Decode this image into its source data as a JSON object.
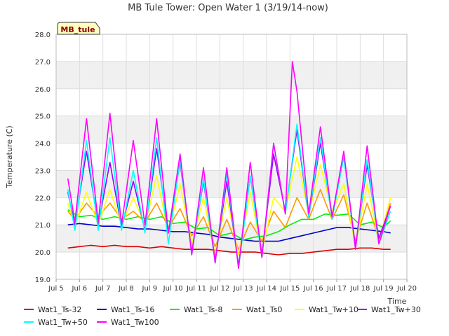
{
  "chart_data": {
    "type": "line",
    "title": "MB Tule Tower: Open Water 1 (3/19/14-now)",
    "xlabel": "Time",
    "ylabel": "Temperature (C)",
    "ylim": [
      19.0,
      28.0
    ],
    "xlim": [
      5,
      20
    ],
    "yticks": [
      "19.0",
      "20.0",
      "21.0",
      "22.0",
      "23.0",
      "24.0",
      "25.0",
      "26.0",
      "27.0",
      "28.0"
    ],
    "xticks": [
      "Jul 5",
      "Jul 6",
      "Jul 7",
      "Jul 8",
      "Jul 9",
      "Jul 10",
      "Jul 11",
      "Jul 12",
      "Jul 13",
      "Jul 14",
      "Jul 15",
      "Jul 16",
      "Jul 17",
      "Jul 18",
      "Jul 19",
      "Jul 20"
    ],
    "x_unit": "day of July",
    "grid": true,
    "station_label": "MB_tule",
    "legend_position": "bottom",
    "series": [
      {
        "name": "Wat1_Ts-32",
        "color": "#dd0000",
        "x": [
          5.5,
          6.0,
          6.5,
          7.0,
          7.5,
          8.0,
          8.5,
          9.0,
          9.5,
          10.0,
          10.5,
          11.0,
          11.5,
          12.0,
          12.5,
          13.0,
          13.5,
          14.0,
          14.5,
          15.0,
          15.5,
          16.0,
          16.5,
          17.0,
          17.5,
          18.0,
          18.5,
          19.0,
          19.3
        ],
        "y": [
          20.15,
          20.2,
          20.25,
          20.2,
          20.25,
          20.2,
          20.2,
          20.15,
          20.2,
          20.15,
          20.1,
          20.1,
          20.1,
          20.05,
          20.0,
          20.0,
          20.0,
          19.95,
          19.9,
          19.95,
          19.95,
          20.0,
          20.05,
          20.1,
          20.1,
          20.15,
          20.15,
          20.1,
          20.1
        ]
      },
      {
        "name": "Wat1_Ts-16",
        "color": "#0000cc",
        "x": [
          5.5,
          6.0,
          6.5,
          7.0,
          7.5,
          8.0,
          8.5,
          9.0,
          9.5,
          10.0,
          10.5,
          11.0,
          11.5,
          12.0,
          12.5,
          13.0,
          13.5,
          14.0,
          14.5,
          15.0,
          15.5,
          16.0,
          16.5,
          17.0,
          17.5,
          18.0,
          18.5,
          19.0,
          19.3
        ],
        "y": [
          21.0,
          21.05,
          21.0,
          20.95,
          20.95,
          20.9,
          20.85,
          20.85,
          20.8,
          20.75,
          20.75,
          20.7,
          20.65,
          20.55,
          20.5,
          20.45,
          20.4,
          20.4,
          20.4,
          20.5,
          20.6,
          20.7,
          20.8,
          20.9,
          20.9,
          20.85,
          20.8,
          20.75,
          20.7
        ]
      },
      {
        "name": "Wat1_Ts-8",
        "color": "#00ee00",
        "x": [
          5.5,
          6.0,
          6.5,
          7.0,
          7.5,
          8.0,
          8.5,
          9.0,
          9.5,
          10.0,
          10.5,
          11.0,
          11.5,
          12.0,
          12.5,
          13.0,
          13.5,
          14.0,
          14.5,
          15.0,
          15.5,
          16.0,
          16.5,
          17.0,
          17.5,
          18.0,
          18.5,
          19.0,
          19.3
        ],
        "y": [
          21.55,
          21.3,
          21.35,
          21.2,
          21.3,
          21.2,
          21.3,
          21.2,
          21.3,
          21.05,
          21.1,
          20.85,
          20.9,
          20.6,
          20.7,
          20.45,
          20.55,
          20.6,
          20.75,
          21.0,
          21.2,
          21.2,
          21.4,
          21.35,
          21.4,
          21.0,
          21.1,
          20.9,
          21.15
        ]
      },
      {
        "name": "Wat1_Ts0",
        "color": "#ff9900",
        "x": [
          5.5,
          5.8,
          6.3,
          6.8,
          7.3,
          7.8,
          8.3,
          8.8,
          9.3,
          9.8,
          10.3,
          10.8,
          11.3,
          11.8,
          12.3,
          12.8,
          13.3,
          13.8,
          14.3,
          14.8,
          15.3,
          15.8,
          16.3,
          16.8,
          17.3,
          17.8,
          18.3,
          18.8,
          19.3
        ],
        "y": [
          21.5,
          21.2,
          21.8,
          21.3,
          21.8,
          21.2,
          21.5,
          21.1,
          21.8,
          20.9,
          21.6,
          20.6,
          21.3,
          20.2,
          21.2,
          20.1,
          21.1,
          20.4,
          21.5,
          20.9,
          22.0,
          21.2,
          22.3,
          21.2,
          22.1,
          20.4,
          21.8,
          20.5,
          21.8
        ]
      },
      {
        "name": "Wat1_Tw+10",
        "color": "#ffff00",
        "x": [
          5.5,
          5.8,
          6.3,
          6.8,
          7.3,
          7.8,
          8.3,
          8.8,
          9.3,
          9.8,
          10.3,
          10.8,
          11.3,
          11.8,
          12.3,
          12.8,
          13.3,
          13.8,
          14.3,
          14.8,
          15.3,
          15.8,
          16.3,
          16.8,
          17.3,
          17.8,
          18.3,
          18.8,
          19.3
        ],
        "y": [
          21.8,
          21.0,
          22.2,
          21.0,
          22.3,
          21.0,
          22.0,
          21.0,
          22.8,
          20.7,
          22.5,
          20.3,
          22.0,
          19.9,
          22.0,
          19.9,
          22.2,
          20.0,
          22.0,
          21.5,
          23.5,
          21.4,
          23.2,
          21.5,
          22.5,
          20.2,
          22.5,
          20.4,
          22.0
        ]
      },
      {
        "name": "Wat1_Tw+30",
        "color": "#9900ff",
        "x": [
          5.5,
          5.8,
          6.3,
          6.8,
          7.3,
          7.8,
          8.3,
          8.8,
          9.3,
          9.8,
          10.3,
          10.8,
          11.3,
          11.8,
          12.3,
          12.8,
          13.3,
          13.8,
          14.3,
          14.8,
          15.3,
          15.8,
          16.3,
          16.8,
          17.3,
          17.8,
          18.3,
          18.8,
          19.3
        ],
        "y": [
          22.2,
          21.0,
          23.7,
          21.0,
          23.3,
          20.9,
          22.6,
          20.8,
          23.8,
          20.7,
          23.3,
          20.0,
          22.6,
          19.7,
          22.6,
          19.5,
          22.8,
          19.9,
          23.6,
          21.5,
          24.5,
          21.3,
          24.0,
          21.3,
          23.5,
          20.2,
          23.2,
          20.5,
          21.7
        ]
      },
      {
        "name": "Wat1_Tw+50",
        "color": "#00ffff",
        "x": [
          5.5,
          5.8,
          6.3,
          6.8,
          7.3,
          7.8,
          8.3,
          8.8,
          9.3,
          9.8,
          10.3,
          10.8,
          11.3,
          11.8,
          12.3,
          12.8,
          13.3,
          13.8,
          14.3,
          14.8,
          15.3,
          15.8,
          16.3,
          16.8,
          17.3,
          17.8,
          18.3,
          18.8,
          19.3
        ],
        "y": [
          22.3,
          20.8,
          24.1,
          20.8,
          24.2,
          20.8,
          23.0,
          20.7,
          24.2,
          20.3,
          23.4,
          19.9,
          22.7,
          19.6,
          22.9,
          19.4,
          22.8,
          19.8,
          24.0,
          21.4,
          24.7,
          21.3,
          24.2,
          21.2,
          23.5,
          20.1,
          23.4,
          20.3,
          21.5
        ]
      },
      {
        "name": "Wat1_Tw100",
        "color": "#ff00ff",
        "x": [
          5.5,
          5.8,
          6.3,
          6.8,
          7.3,
          7.8,
          8.3,
          8.8,
          9.3,
          9.8,
          10.3,
          10.8,
          11.3,
          11.8,
          12.3,
          12.8,
          13.3,
          13.8,
          14.3,
          14.8,
          15.1,
          15.3,
          15.8,
          16.3,
          16.8,
          17.3,
          17.8,
          18.3,
          18.8,
          19.3
        ],
        "y": [
          22.7,
          21.1,
          24.9,
          21.1,
          25.1,
          21.0,
          24.1,
          21.0,
          24.9,
          20.7,
          23.6,
          19.9,
          23.1,
          19.6,
          23.1,
          19.4,
          23.3,
          19.8,
          24.0,
          21.4,
          27.0,
          25.9,
          21.4,
          24.6,
          21.3,
          23.7,
          20.1,
          23.9,
          20.3,
          21.7
        ]
      }
    ]
  }
}
